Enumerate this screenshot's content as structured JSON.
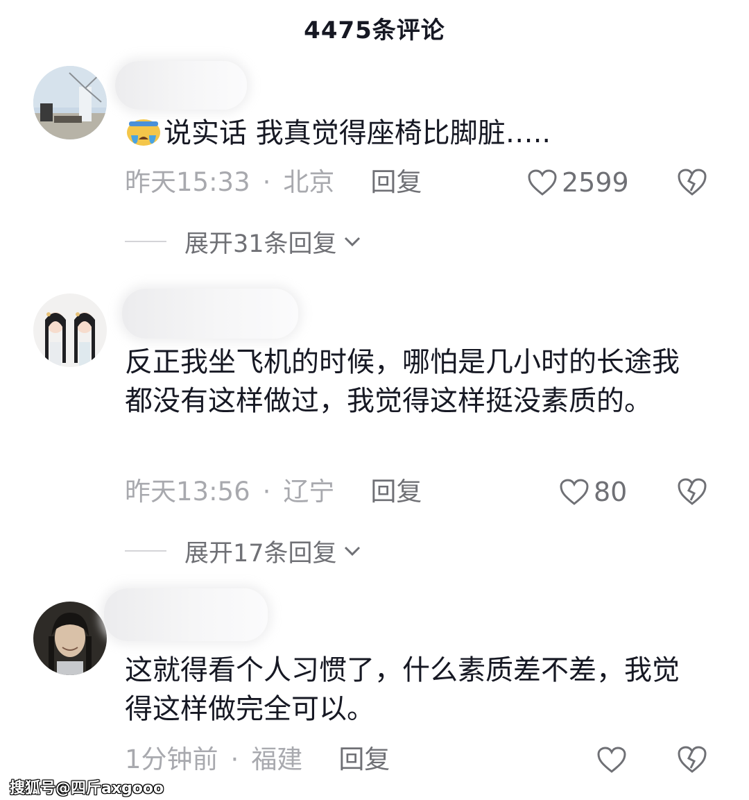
{
  "header": {
    "title": "4475条评论"
  },
  "comments": [
    {
      "text": "说实话 我真觉得座椅比脚脏…..",
      "time": "昨天15:33",
      "location": "北京",
      "reply_label": "回复",
      "likes": "2599",
      "expand_label": "展开31条回复"
    },
    {
      "text": "反正我坐飞机的时候，哪怕是几小时的长途我都没有这样做过，我觉得这样挺没素质的。",
      "time": "昨天13:56",
      "location": "辽宁",
      "reply_label": "回复",
      "likes": "80",
      "expand_label": "展开17条回复"
    },
    {
      "text": "这就得看个人习惯了，什么素质差不差，我觉得这样做完全可以。",
      "time": "1分钟前",
      "location": "福建",
      "reply_label": "回复",
      "likes": ""
    }
  ],
  "separator": "·",
  "watermark": "搜狐号@四斤axgooo",
  "icons": {
    "heart": "heart-outline-icon",
    "dislike": "broken-heart-icon",
    "chevron": "chevron-down-icon",
    "emoji": "crying-face-emoji"
  },
  "colors": {
    "text": "#161823",
    "muted": "#a8a9ae",
    "secondary": "#6f7075"
  }
}
